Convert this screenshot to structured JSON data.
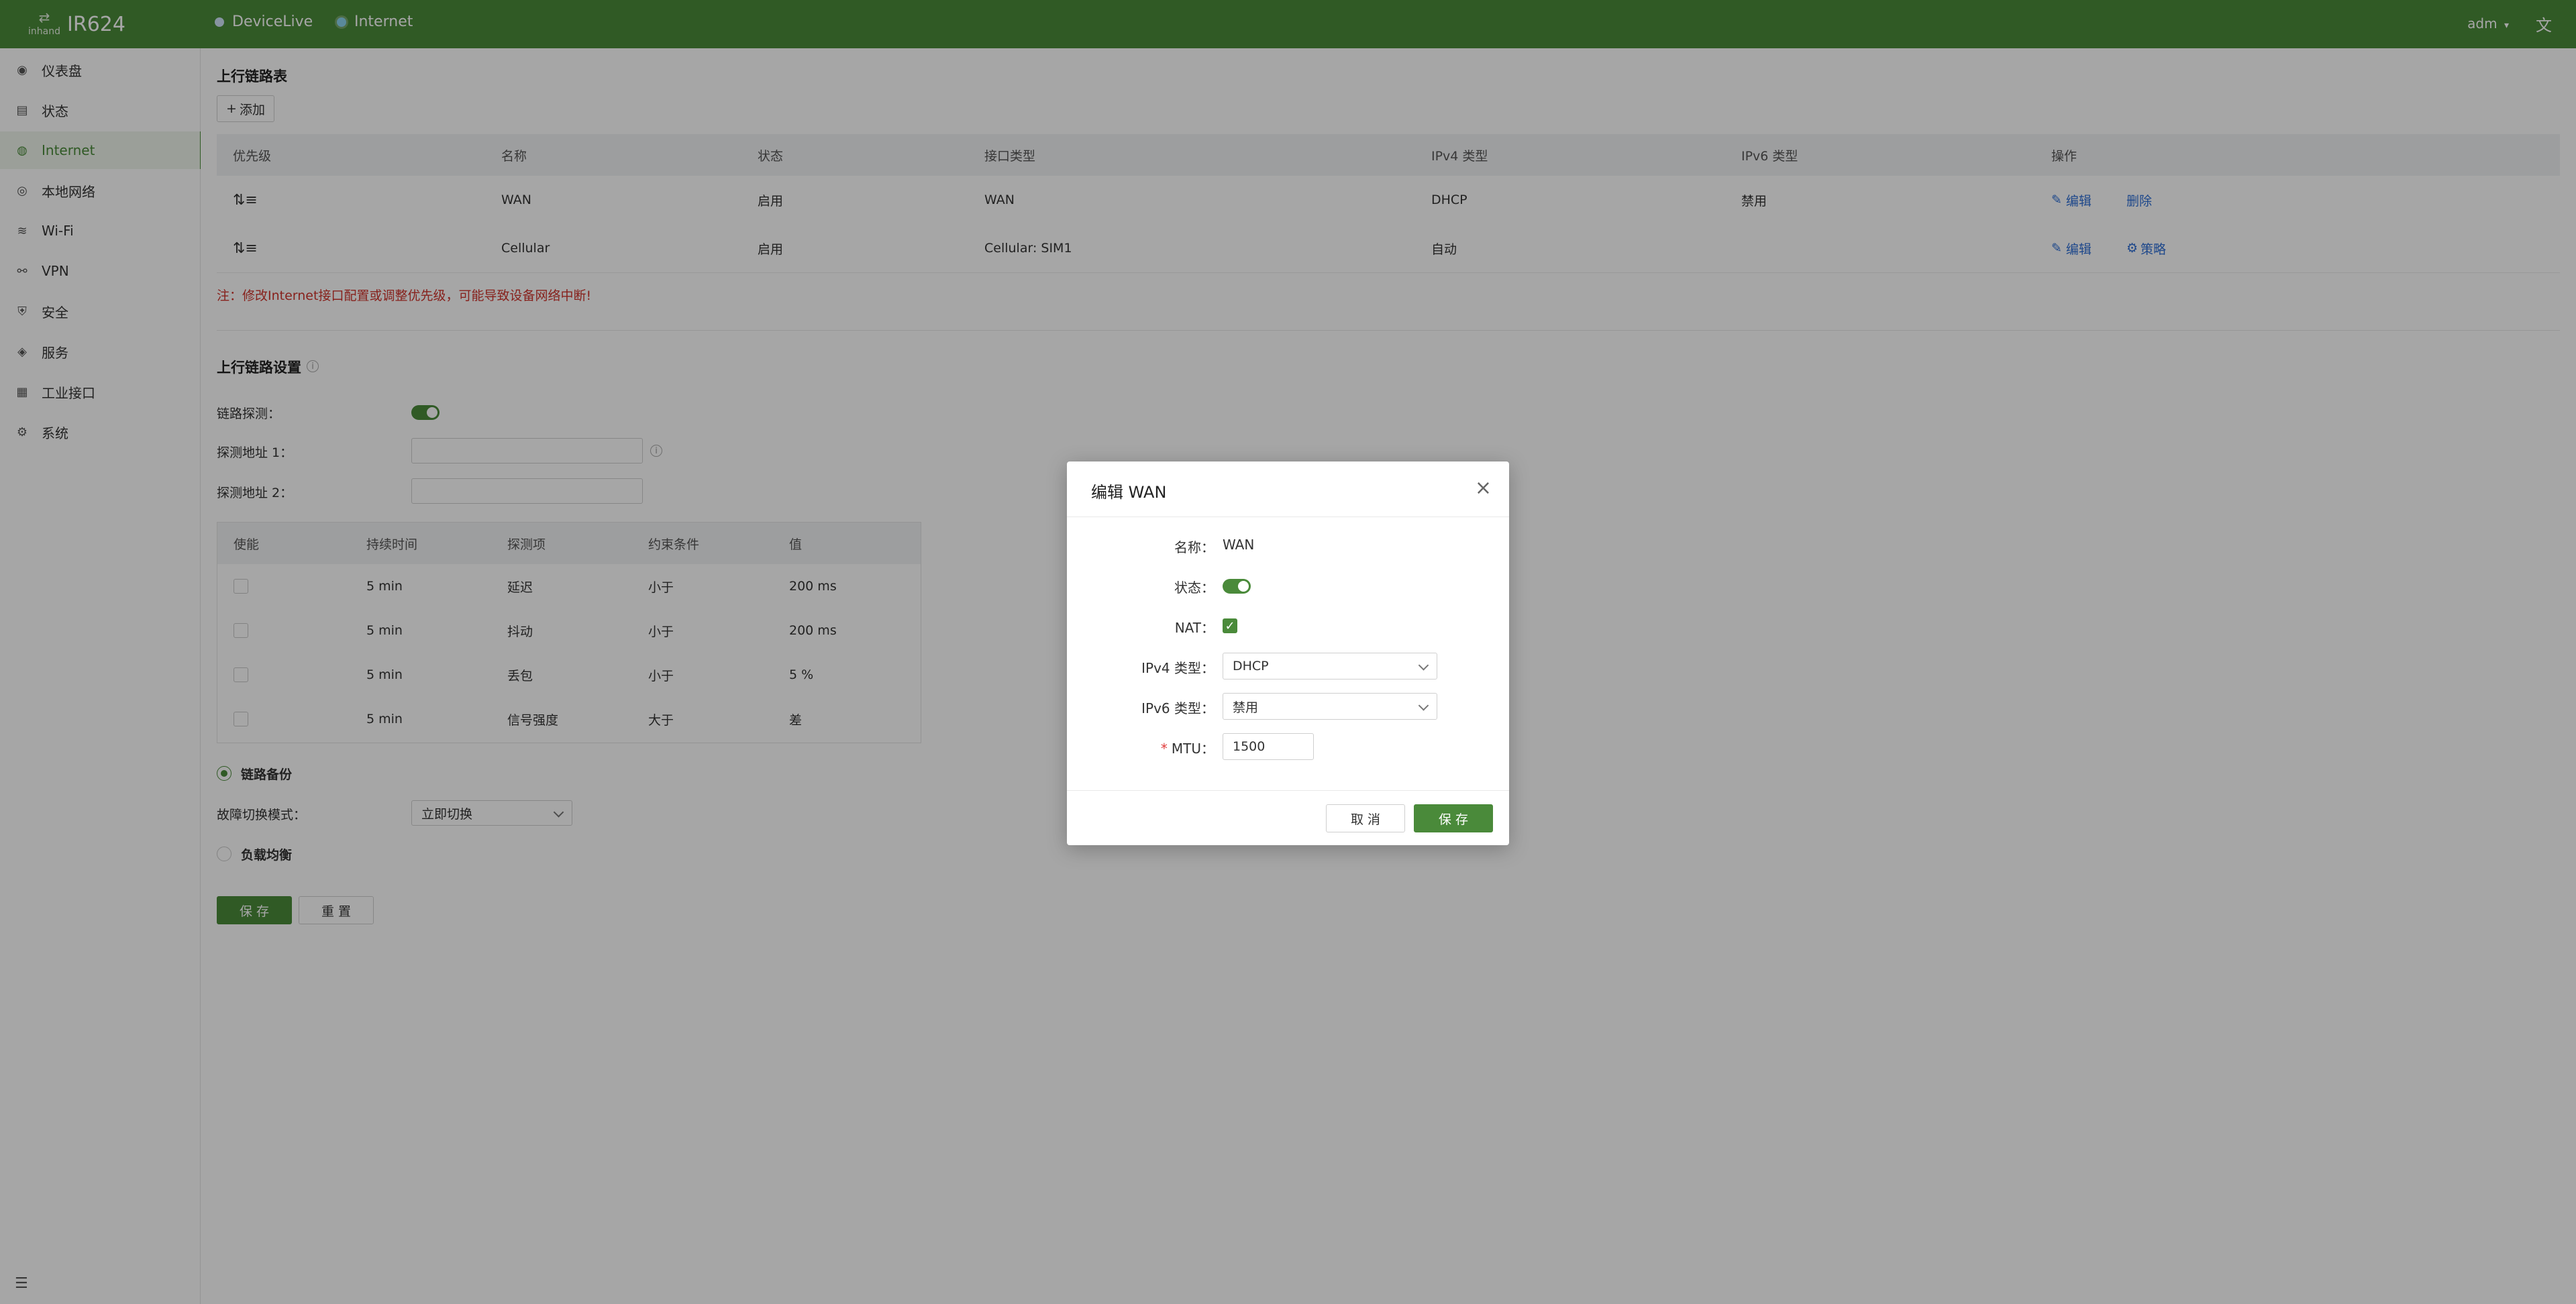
{
  "topbar": {
    "logo_text": "inhand",
    "model": "IR624",
    "nav": [
      {
        "label": "DeviceLive",
        "icon": "cloud-icon"
      },
      {
        "label": "Internet",
        "icon": "globe-icon"
      }
    ],
    "user": "adm",
    "language_icon": "translate-icon"
  },
  "sidebar": {
    "items": [
      {
        "label": "仪表盘",
        "icon": "dashboard-icon",
        "active": false
      },
      {
        "label": "状态",
        "icon": "status-icon",
        "active": false
      },
      {
        "label": "Internet",
        "icon": "internet-icon",
        "active": true
      },
      {
        "label": "本地网络",
        "icon": "local-network-icon",
        "active": false
      },
      {
        "label": "Wi-Fi",
        "icon": "wifi-icon",
        "active": false
      },
      {
        "label": "VPN",
        "icon": "vpn-icon",
        "active": false
      },
      {
        "label": "安全",
        "icon": "security-icon",
        "active": false
      },
      {
        "label": "服务",
        "icon": "service-icon",
        "active": false
      },
      {
        "label": "工业接口",
        "icon": "industrial-interface-icon",
        "active": false
      },
      {
        "label": "系统",
        "icon": "system-icon",
        "active": false
      }
    ],
    "collapse_icon": "menu-collapse-icon"
  },
  "uplink_table": {
    "title": "上行链路表",
    "add_label": "添加",
    "columns": [
      "优先级",
      "名称",
      "状态",
      "接口类型",
      "IPv4 类型",
      "IPv6 类型",
      "操作"
    ],
    "rows": [
      {
        "name": "WAN",
        "status": "启用",
        "interface": "WAN",
        "ipv4": "DHCP",
        "ipv6": "禁用",
        "action1": "编辑",
        "action2": "删除"
      },
      {
        "name": "Cellular",
        "status": "启用",
        "interface": "Cellular: SIM1",
        "ipv4": "自动",
        "ipv6": "",
        "action1": "编辑",
        "action2": "策略"
      }
    ],
    "note": "注：修改Internet接口配置或调整优先级，可能导致设备网络中断!"
  },
  "uplink_settings": {
    "title": "上行链路设置",
    "link_detect_label": "链路探测：",
    "link_detect_enabled": true,
    "probe1_label": "探测地址 1：",
    "probe1_value": "",
    "probe2_label": "探测地址 2：",
    "probe2_value": "",
    "detect_columns": [
      "使能",
      "持续时间",
      "探测项",
      "约束条件",
      "值"
    ],
    "detect_rows": [
      {
        "duration": "5 min",
        "item": "延迟",
        "condition": "小于",
        "value": "200 ms",
        "enabled": false
      },
      {
        "duration": "5 min",
        "item": "抖动",
        "condition": "小于",
        "value": "200 ms",
        "enabled": false
      },
      {
        "duration": "5 min",
        "item": "丢包",
        "condition": "小于",
        "value": "5 %",
        "enabled": false
      },
      {
        "duration": "5 min",
        "item": "信号强度",
        "condition": "大于",
        "value": "差",
        "enabled": false
      }
    ],
    "backup_label": "链路备份",
    "failover_label": "故障切换模式：",
    "failover_value": "立即切换",
    "loadbalance_label": "负载均衡",
    "save_label": "保 存",
    "reset_label": "重 置"
  },
  "modal": {
    "title": "编辑 WAN",
    "name_label": "名称：",
    "name_value": "WAN",
    "status_label": "状态：",
    "status_enabled": true,
    "nat_label": "NAT：",
    "nat_checked": true,
    "ipv4_label": "IPv4 类型：",
    "ipv4_value": "DHCP",
    "ipv6_label": "IPv6 类型：",
    "ipv6_value": "禁用",
    "mtu_label": "MTU：",
    "mtu_required": "*",
    "mtu_value": "1500",
    "cancel_label": "取 消",
    "save_label": "保 存"
  },
  "colors": {
    "brand": "#4a8a3a",
    "link": "#2f6fd6",
    "warning": "#d0342c"
  }
}
